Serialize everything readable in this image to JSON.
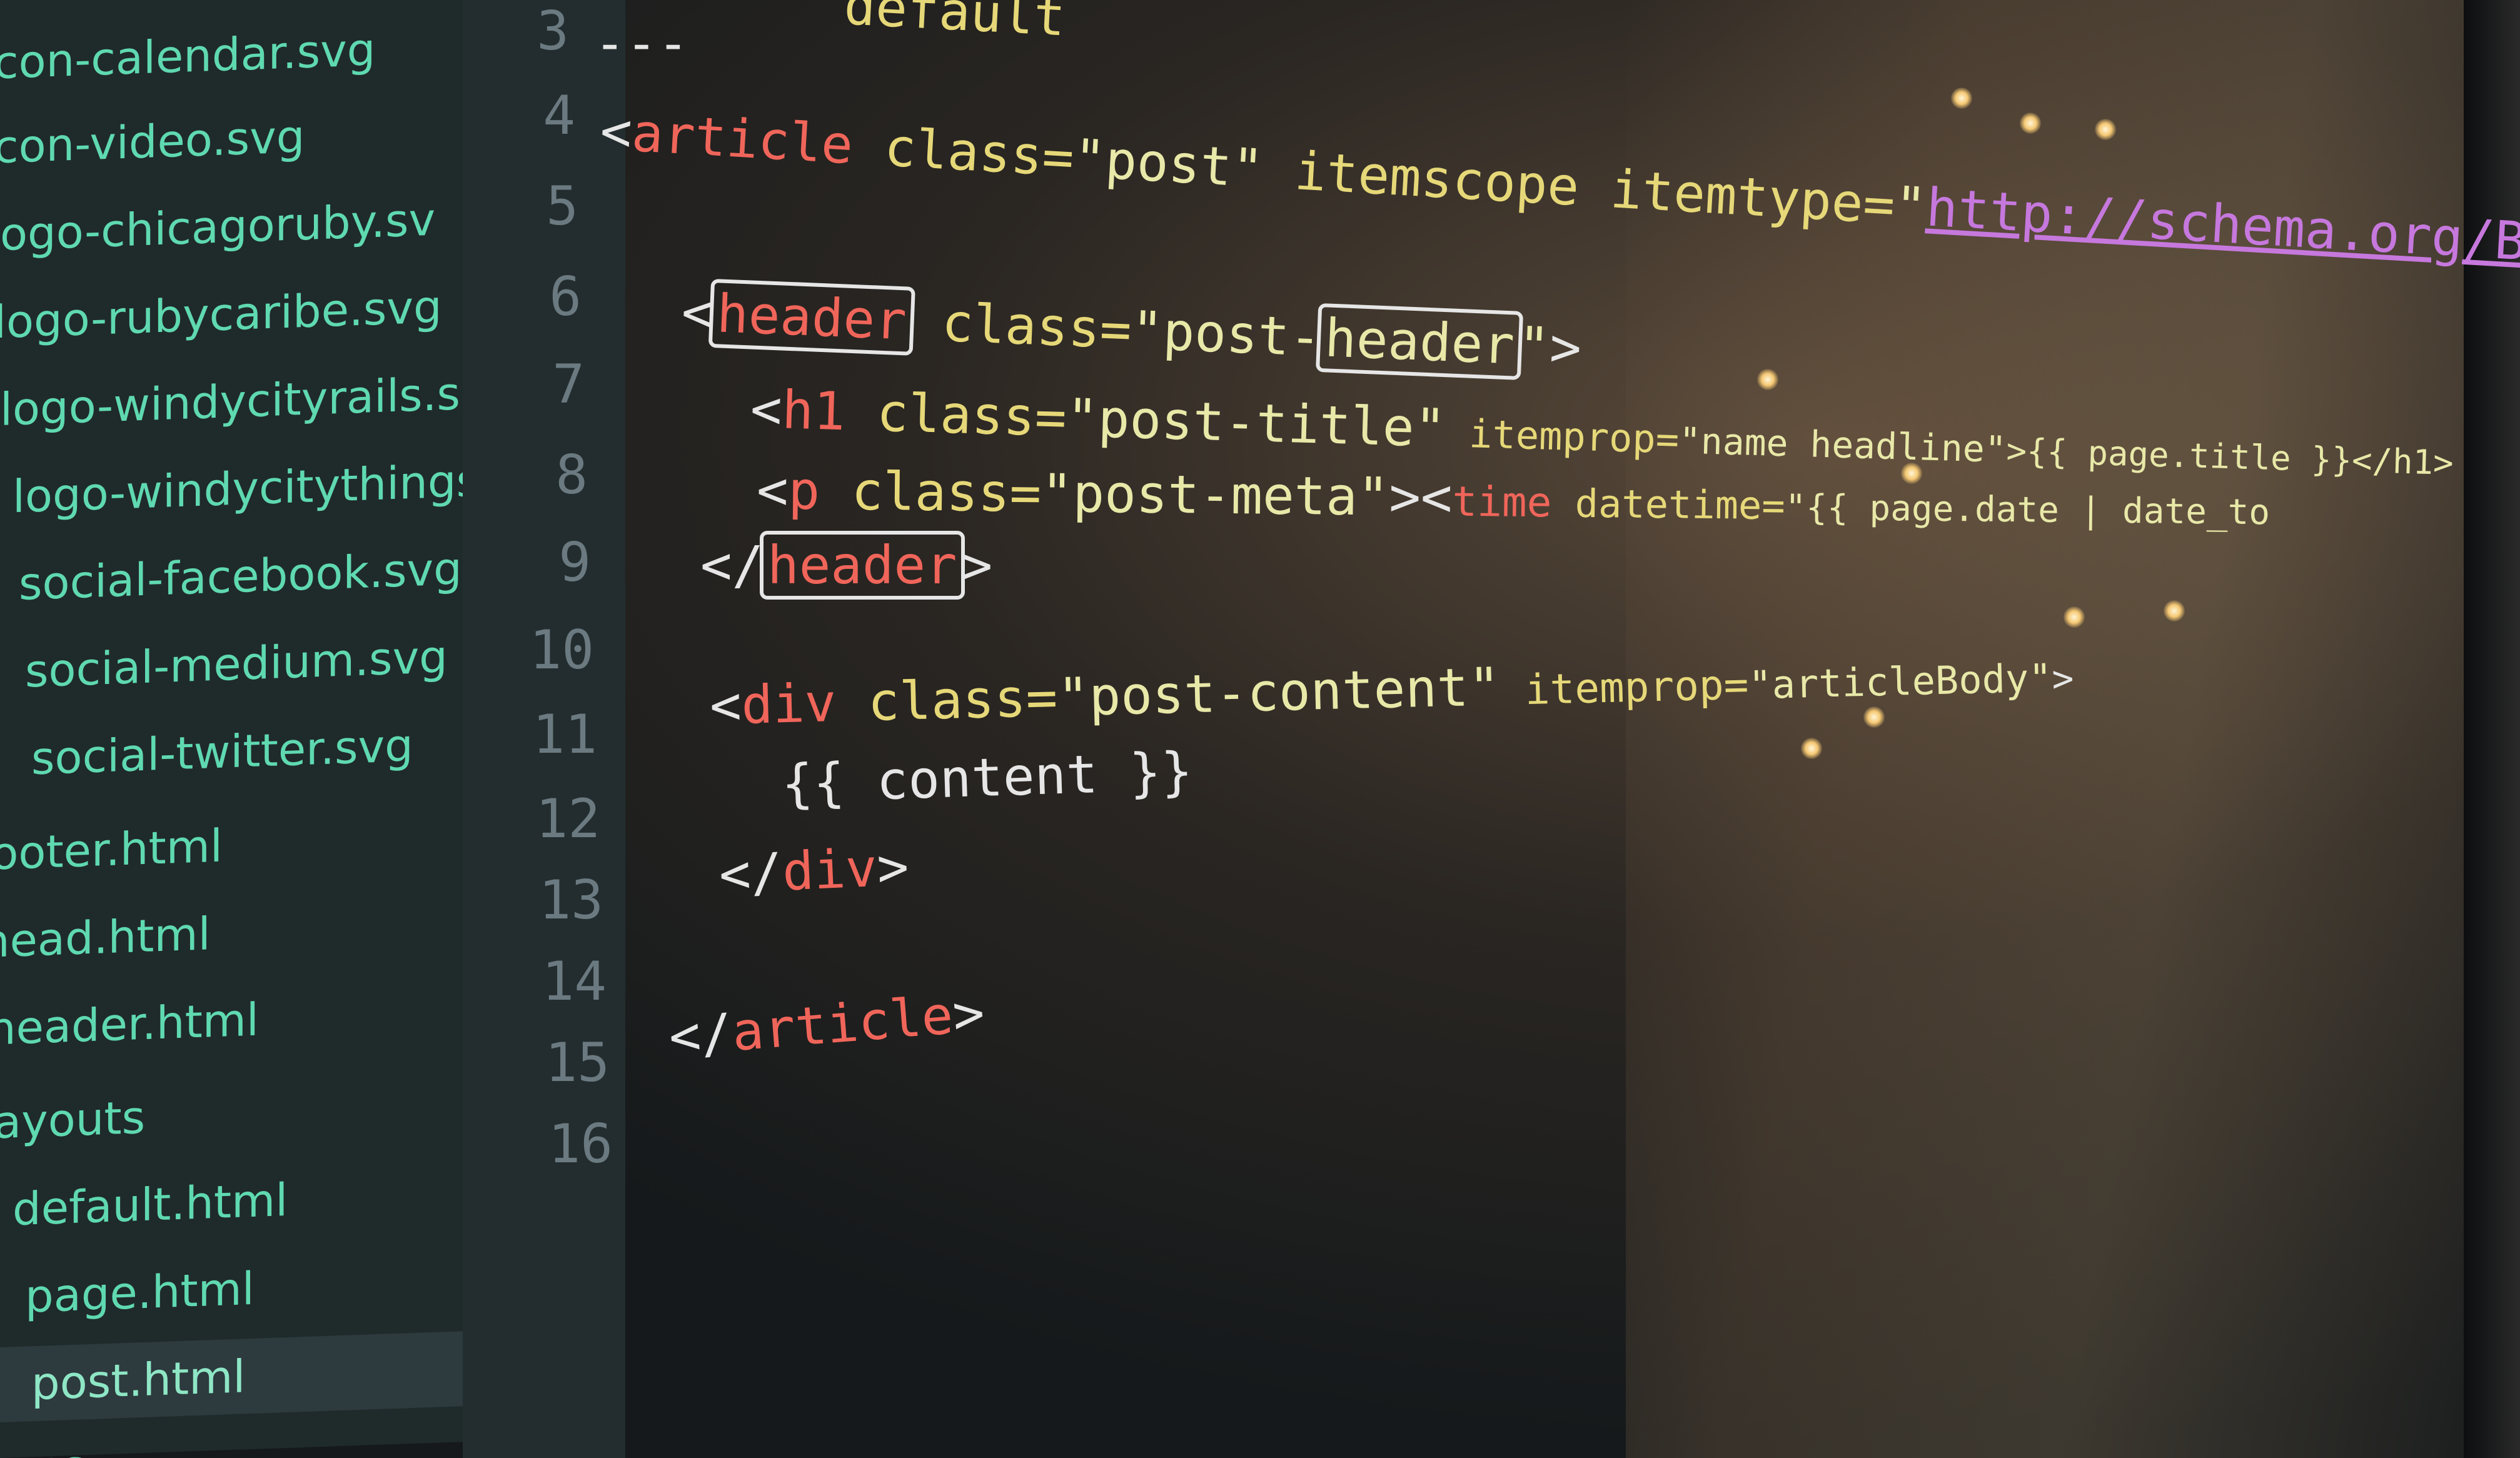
{
  "tree": {
    "items": [
      {
        "label": "icon-calendar.svg",
        "selected": false
      },
      {
        "label": "icon-video.svg",
        "selected": false
      },
      {
        "label": "logo-chicagoruby.sv",
        "selected": false
      },
      {
        "label": "logo-rubycaribe.svg",
        "selected": false
      },
      {
        "label": "logo-windycityrails.s",
        "selected": false
      },
      {
        "label": "logo-windycitythings",
        "selected": false
      },
      {
        "label": "social-facebook.svg",
        "selected": false
      },
      {
        "label": "social-medium.svg",
        "selected": false
      },
      {
        "label": "social-twitter.svg",
        "selected": false
      },
      {
        "label": "footer.html",
        "selected": false
      },
      {
        "label": "head.html",
        "selected": false
      },
      {
        "label": "header.html",
        "selected": false
      },
      {
        "label": "layouts",
        "selected": false
      },
      {
        "label": "default.html",
        "selected": false
      },
      {
        "label": "page.html",
        "selected": false
      },
      {
        "label": "post.html",
        "selected": true
      },
      {
        "label": "sass",
        "selected": false
      }
    ]
  },
  "gutter": {
    "line_numbers": [
      "3",
      "4",
      "5",
      "6",
      "7",
      "8",
      "9",
      "10",
      "11",
      "12",
      "13",
      "14",
      "15",
      "16"
    ]
  },
  "editor": {
    "top_fragment": "default",
    "line3": "---",
    "line4": {
      "open": "<",
      "tag": "article",
      "attr1": " class=",
      "val1": "\"post\"",
      "attr2": " itemscope itemtype=",
      "q": "\"",
      "link": "http://schema.org/BlogPosting",
      "end": "\">"
    },
    "line6": {
      "open": "<",
      "tag": "header",
      "attr": " class=",
      "val_pre": "\"post-",
      "val_match": "header",
      "val_post": "\"",
      "end": ">"
    },
    "line7": {
      "open": "<",
      "tag": "h1",
      "attr1": " class=",
      "val1": "\"post-title\"",
      "attr2": " itemprop=",
      "val2": "\"name headline\"",
      "rest": ">{{ page.title }}</h1>"
    },
    "line8": {
      "open": "<",
      "tag": "p",
      "attr1": " class=",
      "val1": "\"post-meta\"",
      "mid": "><",
      "tag2": "time",
      "attr2": " datetime=",
      "val2": "\"{{ page.date | date_to"
    },
    "line9": {
      "open": "</",
      "tag": "header",
      "end": ">"
    },
    "line11": {
      "open": "<",
      "tag": "div",
      "attr1": " class=",
      "val1": "\"post-content\"",
      "attr2": " itemprop=",
      "val2": "\"articleBody\"",
      "end": ">"
    },
    "line12": "{{ content }}",
    "line13": {
      "open": "</",
      "tag": "div",
      "end": ">"
    },
    "line15": {
      "open": "</",
      "tag": "article",
      "end": ">"
    }
  },
  "colors": {
    "tag": "#f0655a",
    "attribute": "#e6d878",
    "string": "#e8e8a8",
    "link": "#c678dd",
    "tree_text": "#5fd9b0",
    "line_number": "#6b7a80"
  }
}
